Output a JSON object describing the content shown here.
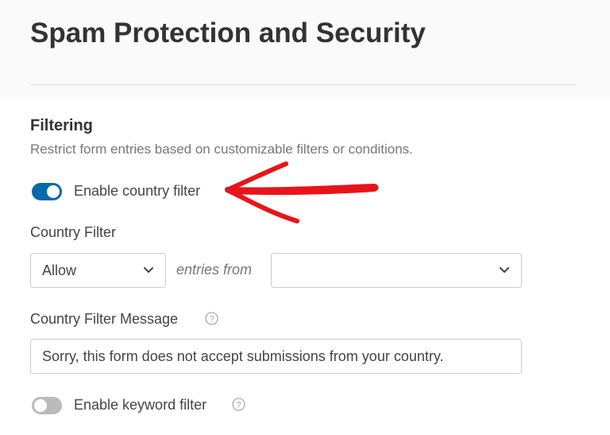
{
  "page": {
    "title": "Spam Protection and Security"
  },
  "filtering": {
    "heading": "Filtering",
    "description": "Restrict form entries based on customizable filters or conditions.",
    "country_toggle": {
      "label": "Enable country filter",
      "enabled": true
    },
    "country_filter": {
      "label": "Country Filter",
      "mode_selected": "Allow",
      "connector_text": "entries from",
      "countries_selected": ""
    },
    "country_message": {
      "label": "Country Filter Message",
      "value": "Sorry, this form does not accept submissions from your country.",
      "help_icon": "question-circle-icon"
    },
    "keyword_toggle": {
      "label": "Enable keyword filter",
      "enabled": false,
      "help_icon": "question-circle-icon"
    }
  },
  "annotation": {
    "arrow_color": "#e8141b",
    "icon": "hand-drawn-arrow-icon"
  },
  "colors": {
    "toggle_on": "#036aab",
    "toggle_off": "#bbbbbb",
    "heading_text": "#333333",
    "muted_text": "#777777",
    "border": "#cccccc"
  }
}
